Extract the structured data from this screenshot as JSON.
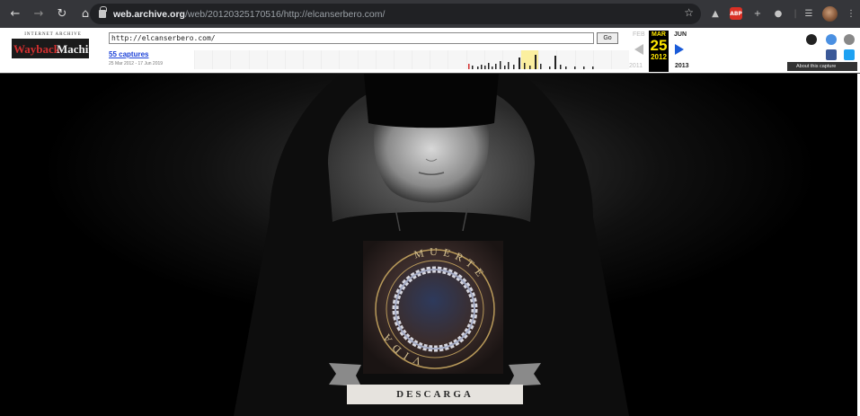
{
  "browser": {
    "url_host": "web.archive.org",
    "url_path": "/web/20120325170516/http://elcanserbero.com/",
    "ext_badge": "ABP"
  },
  "wayback": {
    "logo_top": "INTERNET ARCHIVE",
    "logo_main": "WaybackMachine",
    "url_value": "http://elcanserbero.com/",
    "go_label": "Go",
    "captures_label": "55 captures",
    "capture_range": "25 Mar 2012 - 17 Jun 2019",
    "month_prev": "FEB",
    "month_cur": "MAR",
    "month_next": "JUN",
    "day_cur": "25",
    "year_prev": "2011",
    "year_cur": "2012",
    "year_next": "2013",
    "about_label": "About this capture"
  },
  "page": {
    "emblem_top": "MUERTE",
    "emblem_bottom": "VIDA",
    "download_label": "DESCARGA"
  },
  "colors": {
    "chrome_bg": "#35363a",
    "wayback_highlight": "#fbef9f",
    "calendar_current": "#ffe600",
    "link_blue": "#1a40d8",
    "page_bg": "#000000"
  }
}
